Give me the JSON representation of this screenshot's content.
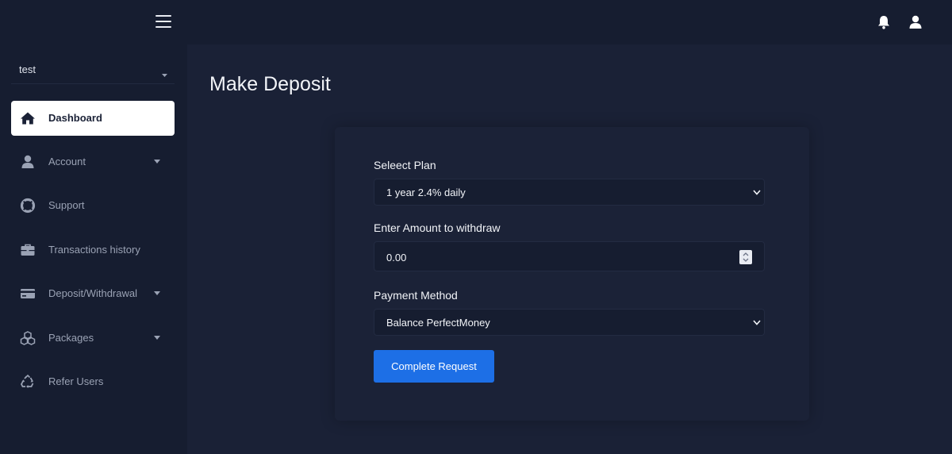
{
  "header": {
    "menu_icon": "hamburger-menu-icon",
    "notifications_icon": "bell-icon",
    "profile_icon": "user-icon"
  },
  "sidebar": {
    "user": {
      "name": "test"
    },
    "items": [
      {
        "label": "Dashboard",
        "icon": "home-icon",
        "active": true,
        "has_submenu": false
      },
      {
        "label": "Account",
        "icon": "user-icon",
        "active": false,
        "has_submenu": true
      },
      {
        "label": "Support",
        "icon": "lifebuoy-icon",
        "active": false,
        "has_submenu": false
      },
      {
        "label": "Transactions history",
        "icon": "briefcase-icon",
        "active": false,
        "has_submenu": false
      },
      {
        "label": "Deposit/Withdrawal",
        "icon": "credit-card-icon",
        "active": false,
        "has_submenu": true
      },
      {
        "label": "Packages",
        "icon": "cubes-icon",
        "active": false,
        "has_submenu": true
      },
      {
        "label": "Refer Users",
        "icon": "recycle-icon",
        "active": false,
        "has_submenu": false
      }
    ]
  },
  "main": {
    "title": "Make Deposit",
    "form": {
      "plan_label": "Seleect Plan",
      "plan_value": "1 year 2.4% daily",
      "amount_label": "Enter Amount to withdraw",
      "amount_value": "0.00",
      "payment_label": "Payment Method",
      "payment_value": "Balance PerfectMoney",
      "submit_label": "Complete Request"
    }
  },
  "colors": {
    "background": "#1a2136",
    "sidebar": "#161d30",
    "primary": "#1d6fe6",
    "active_item": "#ffffff"
  }
}
